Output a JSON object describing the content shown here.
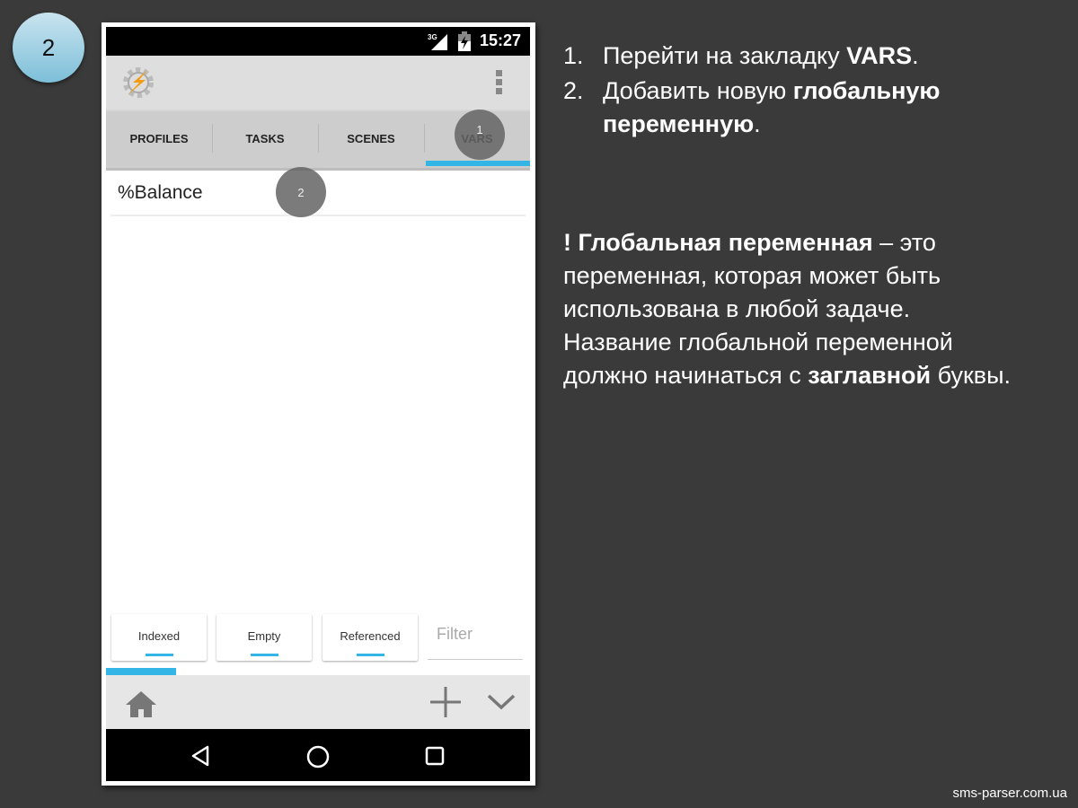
{
  "slide": {
    "step_number": "2",
    "instructions": [
      {
        "num": "1.",
        "text": "Перейти на закладку ",
        "bold": "VARS",
        "end": "."
      },
      {
        "num": "2.",
        "text": "Добавить новую ",
        "bold": "глобальную переменную",
        "end": "."
      }
    ],
    "note": {
      "bang": "! ",
      "bold_lead": "Глобальная переменная",
      "text1": " – это переменная, которая может быть использована в любой задаче. Название глобальной переменной должно начинаться с ",
      "bold_tail": "заглавной",
      "text2": " буквы."
    },
    "footer": "sms-parser.com.ua"
  },
  "phone": {
    "status": {
      "network": "3G",
      "time": "15:27",
      "icons": [
        "signal-icon",
        "battery-charging-icon"
      ]
    },
    "actionbar": {
      "app_icon": "tasker-gear-bolt-icon",
      "menu_icon": "overflow-menu-icon"
    },
    "tabs": [
      {
        "label": "PROFILES",
        "active": false
      },
      {
        "label": "TASKS",
        "active": false
      },
      {
        "label": "SCENES",
        "active": false
      },
      {
        "label": "VARS",
        "active": true
      }
    ],
    "variables": [
      {
        "name": "%Balance"
      }
    ],
    "markers": [
      "1",
      "2"
    ],
    "filters": [
      {
        "label": "Indexed"
      },
      {
        "label": "Empty"
      },
      {
        "label": "Referenced"
      }
    ],
    "filter_placeholder": "Filter",
    "bottombar": {
      "left_icon": "home-icon",
      "add_icon": "plus-icon",
      "collapse_icon": "chevron-down-icon"
    },
    "navbar": [
      "back-icon",
      "home-circle-icon",
      "recents-icon"
    ],
    "accent_color": "#33b5e5"
  }
}
